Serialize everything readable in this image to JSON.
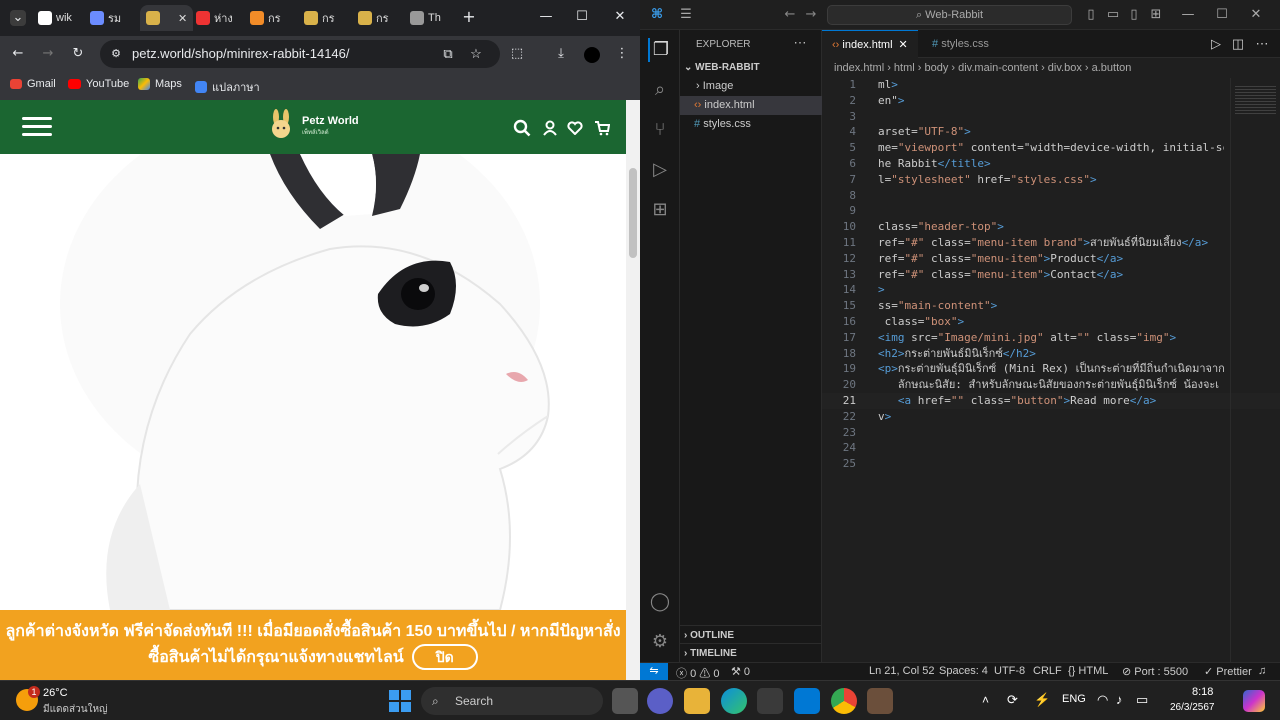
{
  "browser": {
    "tabs": [
      {
        "label": "wik",
        "icon": "github-icon"
      },
      {
        "label": "รม",
        "icon": "site-icon"
      },
      {
        "label": "",
        "icon": "petz-icon",
        "active": true
      },
      {
        "label": "ห่าง",
        "icon": "site-icon"
      },
      {
        "label": "กร",
        "icon": "site-icon"
      },
      {
        "label": "กร",
        "icon": "site-icon"
      },
      {
        "label": "กร",
        "icon": "site-icon"
      },
      {
        "label": "Th",
        "icon": "globe-icon"
      }
    ],
    "url": "petz.world/shop/minirex-rabbit-14146/",
    "bookmarks": [
      "Gmail",
      "YouTube",
      "Maps",
      "แปลภาษา"
    ]
  },
  "site": {
    "brand": "Petz World",
    "brand_sub": "เพ็ทส์เวิลด์",
    "banner_line1": "ลูกค้าต่างจังหวัด ฟรีค่าจัดส่งทันที !!! เมื่อมียอดสั่งซื้อสินค้า 150 บาทขึ้นไป / หากมีปัญหาสั่ง",
    "banner_line2": "ซื้อสินค้าไม่ได้กรุณาแจ้งทางแชทไลน์",
    "banner_close": "ปิด",
    "colors": {
      "header": "#1b6631",
      "banner": "#f2a21f"
    }
  },
  "vscode": {
    "command_center": "Web-Rabbit",
    "explorer_title": "EXPLORER",
    "project": "WEB-RABBIT",
    "files": [
      "Image",
      "index.html",
      "styles.css"
    ],
    "outline": "OUTLINE",
    "timeline": "TIMELINE",
    "tabs": [
      "index.html",
      "styles.css"
    ],
    "breadcrumb": [
      "index.html",
      "html",
      "body",
      "div.main-content",
      "div.box",
      "a.button"
    ],
    "code_lines": [
      "ml>",
      "en\">",
      "",
      "arset=\"UTF-8\">",
      "me=\"viewport\" content=\"width=device-width, initial-sca",
      "he Rabbit</title>",
      "l=\"stylesheet\" href=\"styles.css\">",
      "",
      "",
      "class=\"header-top\">",
      "ref=\"#\" class=\"menu-item brand\">สายพันธ์ที่นิยมเลี้ยง</a>",
      "ref=\"#\" class=\"menu-item\">Product</a>",
      "ref=\"#\" class=\"menu-item\">Contact</a>",
      ">",
      "ss=\"main-content\">",
      " class=\"box\">",
      "<img src=\"Image/mini.jpg\" alt=\"\" class=\"img\">",
      "<h2>กระต่ายพันธ์มินิเร็กซ์</h2>",
      "<p>กระต่ายพันธุ์มินิเร็กซ์ (Mini Rex) เป็นกระต่ายที่มีถิ่นกำเนิดมาจากป",
      "   ลักษณะนิสัย: สำหรับลักษณะนิสัยของกระต่ายพันธุ์มินิเร็กซ์ น้องจะเ",
      "   <a href=\"\" class=\"button\">Read more</a>",
      "v>",
      "",
      "",
      ""
    ],
    "current_line": 21,
    "status": {
      "errors": "0",
      "warnings": "0",
      "ports_fwd": "0",
      "position": "Ln 21, Col 52",
      "spaces": "Spaces: 4",
      "encoding": "UTF-8",
      "eol": "CRLF",
      "language": "HTML",
      "port": "Port : 5500",
      "prettier": "Prettier"
    }
  },
  "taskbar": {
    "weather_temp": "26°C",
    "weather_desc": "มีแดดส่วนใหญ่",
    "weather_badge": "1",
    "search": "Search",
    "lang": "ENG",
    "time": "8:18",
    "date": "26/3/2567"
  }
}
